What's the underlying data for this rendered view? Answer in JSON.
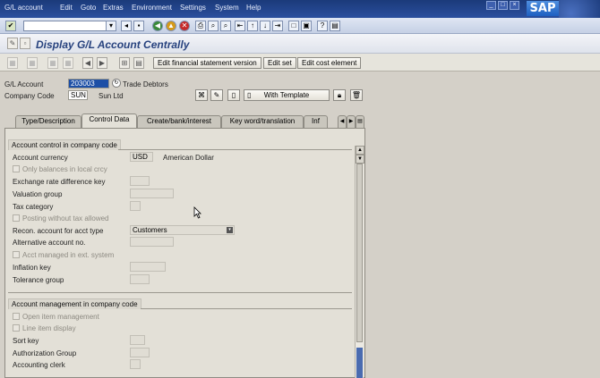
{
  "menu": [
    "G/L account",
    "Edit",
    "Goto",
    "Extras",
    "Environment",
    "Settings",
    "System",
    "Help"
  ],
  "window_controls": [
    "_",
    "□",
    "×"
  ],
  "brand": "SAP",
  "title": "Display G/L Account Centrally",
  "app_buttons": {
    "edit_fs_version": "Edit financial statement version",
    "edit_set": "Edit set",
    "edit_cost_element": "Edit cost element"
  },
  "header": {
    "gl_account_label": "G/L Account",
    "gl_account_value": "203003",
    "gl_account_desc": "Trade Debtors",
    "company_code_label": "Company Code",
    "company_code_value": "SUN",
    "company_code_desc": "Sun Ltd",
    "template_button": "With Template"
  },
  "tabs": [
    "Type/Description",
    "Control Data",
    "Create/bank/interest",
    "Key word/translation",
    "Inf"
  ],
  "active_tab": "Control Data",
  "control_group": {
    "title": "Account control in company code",
    "account_currency_label": "Account currency",
    "account_currency_value": "USD",
    "account_currency_desc": "American Dollar",
    "only_balances_label": "Only balances in local crcy",
    "exchange_rate_label": "Exchange rate difference key",
    "valuation_group_label": "Valuation group",
    "tax_category_label": "Tax category",
    "posting_without_tax_label": "Posting without tax allowed",
    "recon_label": "Recon. account for acct type",
    "recon_value": "Customers",
    "alt_account_label": "Alternative account no.",
    "acct_ext_label": "Acct managed in ext. system",
    "inflation_label": "Inflation key",
    "tolerance_label": "Tolerance group"
  },
  "mgmt_group": {
    "title": "Account management in company code",
    "open_item_label": "Open item management",
    "line_item_label": "Line item display",
    "sort_key_label": "Sort key",
    "auth_group_label": "Authorization Group",
    "clerk_label": "Accounting clerk"
  },
  "colors": {
    "menubar": "#1b3a7a",
    "title": "#27427e",
    "panel": "#e3e0d7",
    "selected_field": "#1d4fa6"
  }
}
